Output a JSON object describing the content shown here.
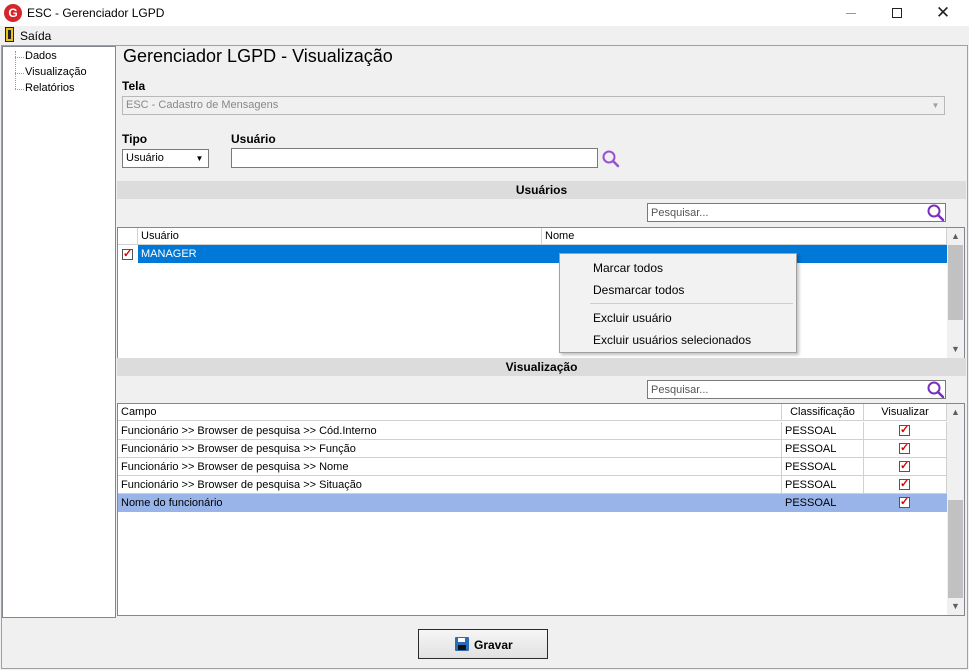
{
  "window": {
    "title": "ESC - Gerenciador LGPD",
    "app_icon": "G"
  },
  "menu": {
    "exit_label": "Saída"
  },
  "tree": {
    "items": [
      "Dados",
      "Visualização",
      "Relatórios"
    ]
  },
  "page": {
    "title": "Gerenciador LGPD - Visualização"
  },
  "form": {
    "tela_label": "Tela",
    "tela_value": "ESC - Cadastro de Mensagens",
    "tipo_label": "Tipo",
    "tipo_value": "Usuário",
    "usuario_label": "Usuário",
    "usuario_value": ""
  },
  "usuarios": {
    "header": "Usuários",
    "search_placeholder": "Pesquisar...",
    "columns": [
      "Usuário",
      "Nome"
    ],
    "rows": [
      {
        "checked": true,
        "usuario": "MANAGER",
        "nome": ""
      }
    ]
  },
  "context_menu": {
    "items": [
      "Marcar todos",
      "Desmarcar todos",
      "Excluir usuário",
      "Excluir usuários selecionados"
    ]
  },
  "visualizacao": {
    "header": "Visualização",
    "search_placeholder": "Pesquisar...",
    "columns": [
      "Campo",
      "Classificação",
      "Visualizar"
    ],
    "rows": [
      {
        "campo": "Funcionário >> Browser de pesquisa >> Cód.Interno",
        "classificacao": "PESSOAL",
        "visualizar": true
      },
      {
        "campo": "Funcionário >> Browser de pesquisa >> Função",
        "classificacao": "PESSOAL",
        "visualizar": true
      },
      {
        "campo": "Funcionário >> Browser de pesquisa >> Nome",
        "classificacao": "PESSOAL",
        "visualizar": true
      },
      {
        "campo": "Funcionário >> Browser de pesquisa >> Situação",
        "classificacao": "PESSOAL",
        "visualizar": true
      },
      {
        "campo": "Nome do funcionário",
        "classificacao": "PESSOAL",
        "visualizar": true
      }
    ]
  },
  "footer": {
    "save_label": "Gravar"
  },
  "colors": {
    "selection": "#0078d7",
    "selection_light": "#99b4e8",
    "search_icon": "#7b2fbf"
  }
}
